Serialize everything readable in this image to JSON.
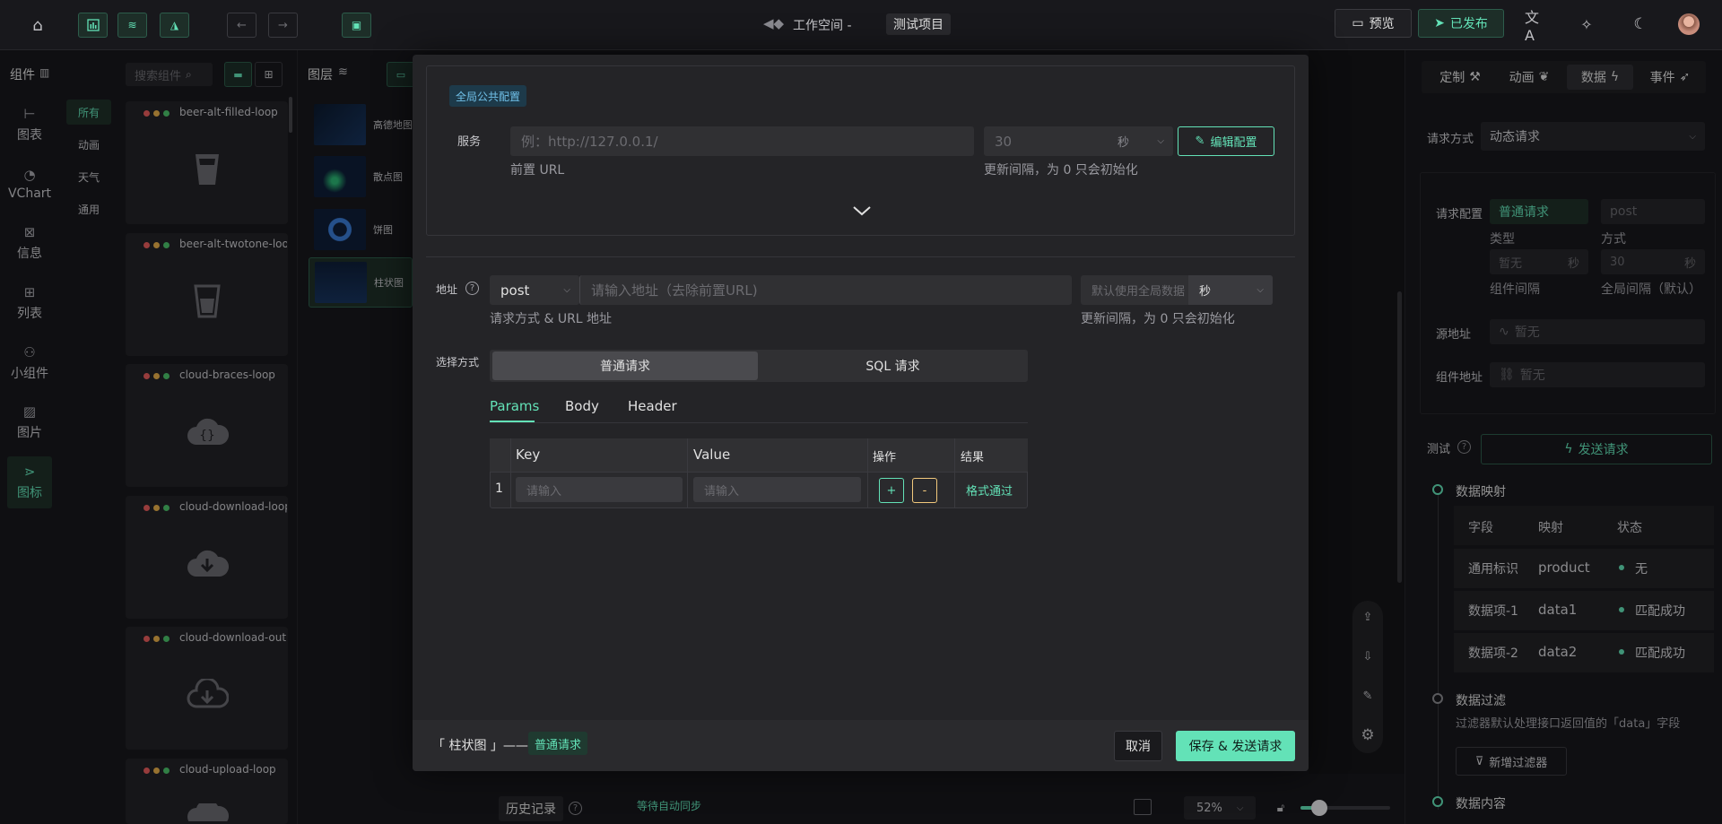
{
  "topbar": {
    "workspace_label": "工作空间 -",
    "project_name": "测试项目",
    "preview_label": "预览",
    "publish_label": "已发布",
    "icons": [
      "home-icon",
      "chart-bar-icon",
      "layers-icon",
      "paint-icon",
      "undo-icon",
      "redo-icon",
      "save-icon",
      "translate-icon",
      "magic-icon",
      "moon-icon",
      "avatar"
    ]
  },
  "components_panel": {
    "title": "组件",
    "search_placeholder": "搜索组件",
    "nav": [
      {
        "label": "图表"
      },
      {
        "label": "VChart"
      },
      {
        "label": "信息"
      },
      {
        "label": "列表"
      },
      {
        "label": "小组件"
      },
      {
        "label": "图片"
      },
      {
        "label": "图标"
      }
    ],
    "categories": [
      "所有",
      "动画",
      "天气",
      "通用"
    ],
    "cards": [
      {
        "name": "beer-alt-filled-loop",
        "icon": "beer-icon"
      },
      {
        "name": "beer-alt-twotone-loop",
        "icon": "beer-outline-icon"
      },
      {
        "name": "cloud-braces-loop",
        "icon": "cloud-braces-icon"
      },
      {
        "name": "cloud-download-loop",
        "icon": "cloud-download-icon"
      },
      {
        "name": "cloud-download-outline-loop",
        "icon": "cloud-download-outline-icon"
      },
      {
        "name": "cloud-upload-loop",
        "icon": "cloud-upload-icon"
      }
    ]
  },
  "layers_panel": {
    "title": "图层",
    "items": [
      {
        "label": "高德地图"
      },
      {
        "label": "散点图"
      },
      {
        "label": "饼图"
      },
      {
        "label": "柱状图"
      }
    ]
  },
  "modal": {
    "global_config_tag": "全局公共配置",
    "service_label": "服务",
    "service_placeholder": "例：http://127.0.0.1/",
    "service_hint": "前置 URL",
    "interval_value": "30",
    "interval_unit": "秒",
    "interval_hint": "更新间隔，为 0 只会初始化",
    "edit_config_label": "编辑配置",
    "address_label": "地址",
    "method_value": "post",
    "url_placeholder": "请输入地址（去除前置URL)",
    "url_hint": "请求方式 & URL 地址",
    "comp_interval_placeholder": "默认使用全局数据",
    "comp_interval_unit": "秒",
    "comp_interval_hint": "更新间隔，为 0 只会初始化",
    "mode_label": "选择方式",
    "mode_options": [
      "普通请求",
      "SQL 请求"
    ],
    "tabs": [
      "Params",
      "Body",
      "Header"
    ],
    "table": {
      "headers": [
        "Key",
        "Value",
        "操作",
        "结果"
      ],
      "rows": [
        {
          "index": "1",
          "key_placeholder": "请输入",
          "value_placeholder": "请输入",
          "add": "+",
          "remove": "-",
          "result": "格式通过"
        }
      ]
    },
    "footer_component": "「 柱状图 」——",
    "footer_tag": "普通请求",
    "cancel_label": "取消",
    "save_label": "保存 & 发送请求"
  },
  "right_panel": {
    "tabs": [
      "定制",
      "动画",
      "数据",
      "事件"
    ],
    "request_method_label": "请求方式",
    "request_method_value": "动态请求",
    "request_config_label": "请求配置",
    "type_value": "普通请求",
    "type_label": "类型",
    "method_value": "post",
    "method_label": "方式",
    "comp_interval_value": "暂无",
    "comp_interval_unit": "秒",
    "comp_interval_label": "组件间隔",
    "global_interval_value": "30",
    "global_interval_unit": "秒",
    "global_interval_label": "全局间隔（默认）",
    "source_label": "源地址",
    "source_value": "暂无",
    "component_url_label": "组件地址",
    "component_url_value": "暂无",
    "test_label": "测试",
    "send_request_label": "发送请求",
    "mapping_title": "数据映射",
    "mapping_headers": [
      "字段",
      "映射",
      "状态"
    ],
    "mapping_rows": [
      {
        "field": "通用标识",
        "map": "product",
        "status": "无"
      },
      {
        "field": "数据项-1",
        "map": "data1",
        "status": "匹配成功"
      },
      {
        "field": "数据项-2",
        "map": "data2",
        "status": "匹配成功"
      }
    ],
    "filter_title": "数据过滤",
    "filter_hint": "过滤器默认处理接口返回值的「data」字段",
    "add_filter_label": "新增过滤器",
    "content_title": "数据内容"
  },
  "bottom_bar": {
    "history_label": "历史记录",
    "sync_status": "等待自动同步",
    "zoom_value": "52%",
    "zoom_fraction": 0.52
  },
  "colors": {
    "accent": "#63e2b7",
    "background": "#18181c",
    "modal_bg": "#242427",
    "warning": "#f2c97d"
  }
}
